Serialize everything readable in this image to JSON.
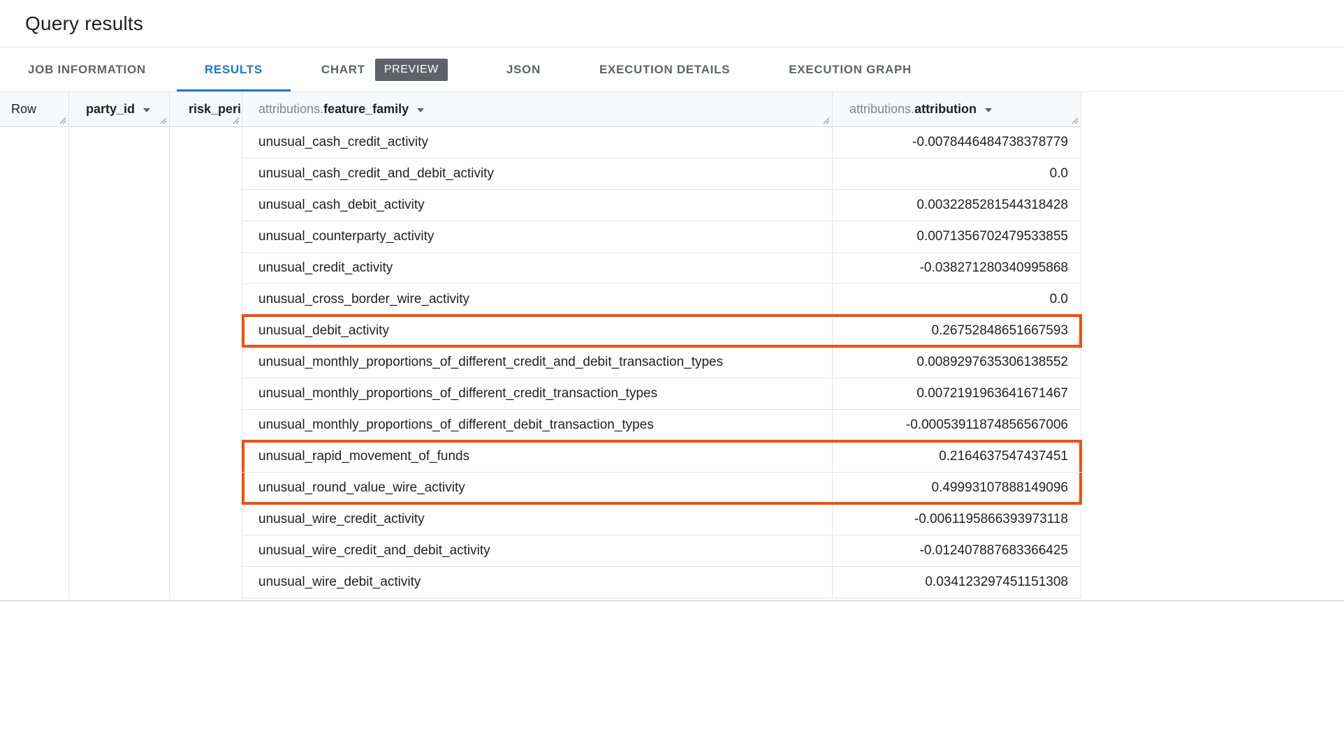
{
  "header": {
    "title": "Query results"
  },
  "tabs": {
    "items": [
      {
        "label": "JOB INFORMATION",
        "active": false
      },
      {
        "label": "RESULTS",
        "active": true
      },
      {
        "label": "CHART",
        "active": false,
        "badge": "PREVIEW"
      },
      {
        "label": "JSON",
        "active": false
      },
      {
        "label": "EXECUTION DETAILS",
        "active": false
      },
      {
        "label": "EXECUTION GRAPH",
        "active": false
      }
    ]
  },
  "table": {
    "columns": [
      {
        "label": "Row"
      },
      {
        "label": "party_id",
        "sortable": true
      },
      {
        "label": "risk_peri"
      },
      {
        "prefix": "attributions.",
        "label": "feature_family",
        "sortable": true
      },
      {
        "prefix": "attributions.",
        "label": "attribution",
        "sortable": true
      }
    ],
    "rows": [
      {
        "feature_family": "unusual_cash_credit_activity",
        "attribution": "-0.0078446484738378779",
        "highlighted": false
      },
      {
        "feature_family": "unusual_cash_credit_and_debit_activity",
        "attribution": "0.0",
        "highlighted": false
      },
      {
        "feature_family": "unusual_cash_debit_activity",
        "attribution": "0.0032285281544318428",
        "highlighted": false
      },
      {
        "feature_family": "unusual_counterparty_activity",
        "attribution": "0.0071356702479533855",
        "highlighted": false
      },
      {
        "feature_family": "unusual_credit_activity",
        "attribution": "-0.038271280340995868",
        "highlighted": false
      },
      {
        "feature_family": "unusual_cross_border_wire_activity",
        "attribution": "0.0",
        "highlighted": false
      },
      {
        "feature_family": "unusual_debit_activity",
        "attribution": "0.26752848651667593",
        "highlighted": true
      },
      {
        "feature_family": "unusual_monthly_proportions_of_different_credit_and_debit_transaction_types",
        "attribution": "0.0089297635306138552",
        "highlighted": false
      },
      {
        "feature_family": "unusual_monthly_proportions_of_different_credit_transaction_types",
        "attribution": "0.0072191963641671467",
        "highlighted": false
      },
      {
        "feature_family": "unusual_monthly_proportions_of_different_debit_transaction_types",
        "attribution": "-0.00053911874856567006",
        "highlighted": false
      },
      {
        "feature_family": "unusual_rapid_movement_of_funds",
        "attribution": "0.2164637547437451",
        "highlighted": true
      },
      {
        "feature_family": "unusual_round_value_wire_activity",
        "attribution": "0.49993107888149096",
        "highlighted": true
      },
      {
        "feature_family": "unusual_wire_credit_activity",
        "attribution": "-0.0061195866393973118",
        "highlighted": false
      },
      {
        "feature_family": "unusual_wire_credit_and_debit_activity",
        "attribution": "-0.012407887683366425",
        "highlighted": false
      },
      {
        "feature_family": "unusual_wire_debit_activity",
        "attribution": "0.034123297451151308",
        "highlighted": false
      }
    ]
  },
  "colors": {
    "accent": "#1a73e8",
    "highlight": "#f84d0b",
    "badge_bg": "#5f6368"
  }
}
